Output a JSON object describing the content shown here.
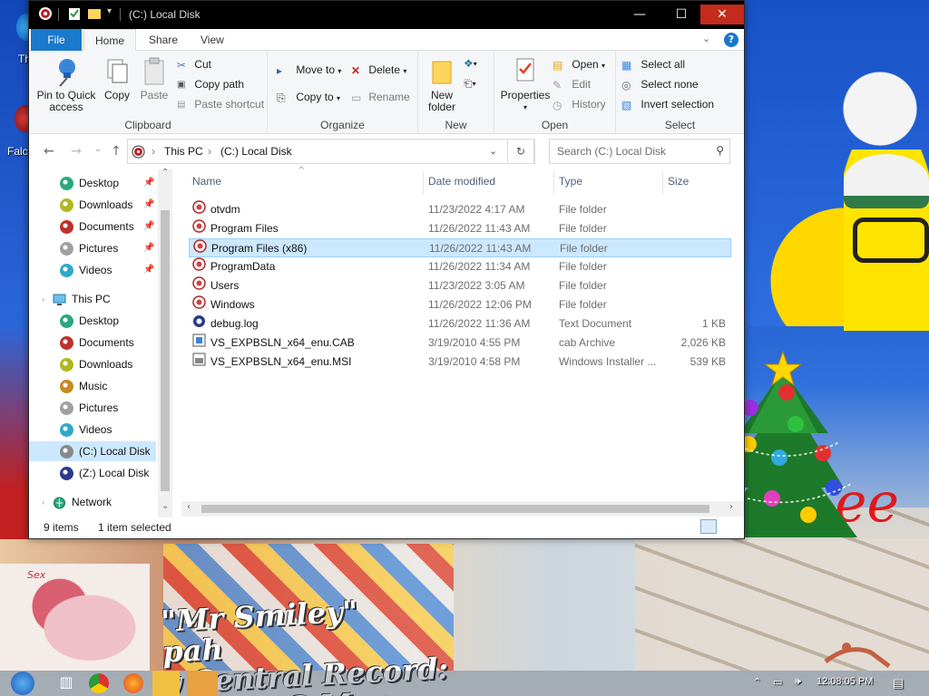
{
  "desktop": {
    "icon_labels": [
      "Th",
      "Falc"
    ],
    "wallpaper_text": [
      "\"Mr Smiley\"",
      "pah",
      "y Central Record:",
      "Smiley G Mon"
    ],
    "red_text": "ee",
    "pony_text": "Sex"
  },
  "window": {
    "title": "(C:) Local Disk",
    "controls": {
      "minimize": "—",
      "maximize": "☐",
      "close": "✕"
    }
  },
  "ribbon": {
    "tabs": [
      "File",
      "Home",
      "Share",
      "View"
    ],
    "active_tab": "Home",
    "groups": {
      "clipboard": {
        "label": "Clipboard",
        "pin": "Pin to Quick\naccess",
        "pin_l1": "Pin to Quick",
        "pin_l2": "access",
        "copy": "Copy",
        "paste": "Paste",
        "cut": "Cut",
        "copy_path": "Copy path",
        "paste_shortcut": "Paste shortcut"
      },
      "organize": {
        "label": "Organize",
        "move_to": "Move to",
        "copy_to": "Copy to",
        "delete": "Delete",
        "rename": "Rename"
      },
      "new": {
        "label": "New",
        "new_folder_l1": "New",
        "new_folder_l2": "folder"
      },
      "open": {
        "label": "Open",
        "properties": "Properties",
        "open": "Open",
        "edit": "Edit",
        "history": "History"
      },
      "select": {
        "label": "Select",
        "select_all": "Select all",
        "select_none": "Select none",
        "invert": "Invert selection"
      }
    }
  },
  "address": {
    "crumbs": [
      "This PC",
      "(C:) Local Disk"
    ],
    "search_placeholder": "Search (C:) Local Disk"
  },
  "nav": {
    "quick_access": [
      {
        "label": "Desktop",
        "icon": "desktop-icon",
        "color": "#2aa87a"
      },
      {
        "label": "Downloads",
        "icon": "downloads-icon",
        "color": "#b0b820"
      },
      {
        "label": "Documents",
        "icon": "documents-icon",
        "color": "#c0302a"
      },
      {
        "label": "Pictures",
        "icon": "pictures-icon",
        "color": "#a0a0a0"
      },
      {
        "label": "Videos",
        "icon": "videos-icon",
        "color": "#30a8c8"
      }
    ],
    "this_pc": "This PC",
    "this_pc_items": [
      {
        "label": "Desktop",
        "icon": "desktop-icon",
        "color": "#2aa87a"
      },
      {
        "label": "Documents",
        "icon": "documents-icon",
        "color": "#c0302a"
      },
      {
        "label": "Downloads",
        "icon": "downloads-icon",
        "color": "#b0b820"
      },
      {
        "label": "Music",
        "icon": "music-icon",
        "color": "#c88a20"
      },
      {
        "label": "Pictures",
        "icon": "pictures-icon",
        "color": "#a0a0a0"
      },
      {
        "label": "Videos",
        "icon": "videos-icon",
        "color": "#30a8c8"
      },
      {
        "label": "(C:) Local Disk",
        "icon": "drive-icon",
        "color": "#888888"
      },
      {
        "label": "(Z:) Local Disk",
        "icon": "drive-icon",
        "color": "#2a3a8a"
      }
    ],
    "network": "Network",
    "selected": "(C:) Local Disk"
  },
  "files": {
    "columns": [
      "Name",
      "Date modified",
      "Type",
      "Size"
    ],
    "rows": [
      {
        "name": "otvdm",
        "date": "11/23/2022 4:17 AM",
        "type": "File folder",
        "size": "",
        "icon": "folder-icon"
      },
      {
        "name": "Program Files",
        "date": "11/26/2022 11:43 AM",
        "type": "File folder",
        "size": "",
        "icon": "folder-icon"
      },
      {
        "name": "Program Files (x86)",
        "date": "11/26/2022 11:43 AM",
        "type": "File folder",
        "size": "",
        "icon": "folder-icon",
        "selected": true
      },
      {
        "name": "ProgramData",
        "date": "11/26/2022 11:34 AM",
        "type": "File folder",
        "size": "",
        "icon": "folder-icon"
      },
      {
        "name": "Users",
        "date": "11/23/2022 3:05 AM",
        "type": "File folder",
        "size": "",
        "icon": "folder-icon"
      },
      {
        "name": "Windows",
        "date": "11/26/2022 12:06 PM",
        "type": "File folder",
        "size": "",
        "icon": "folder-icon"
      },
      {
        "name": "debug.log",
        "date": "11/26/2022 11:36 AM",
        "type": "Text Document",
        "size": "1 KB",
        "icon": "text-file-icon"
      },
      {
        "name": "VS_EXPBSLN_x64_enu.CAB",
        "date": "3/19/2010 4:55 PM",
        "type": "cab Archive",
        "size": "2,026 KB",
        "icon": "cab-file-icon"
      },
      {
        "name": "VS_EXPBSLN_x64_enu.MSI",
        "date": "3/19/2010 4:58 PM",
        "type": "Windows Installer ...",
        "size": "539 KB",
        "icon": "msi-file-icon"
      }
    ]
  },
  "status": {
    "count": "9 items",
    "selection": "1 item selected"
  },
  "taskbar": {
    "clock": "12:08:05 PM"
  },
  "colors": {
    "accent": "#1979ca",
    "selection": "#cce8ff",
    "close": "#c42b1c"
  }
}
